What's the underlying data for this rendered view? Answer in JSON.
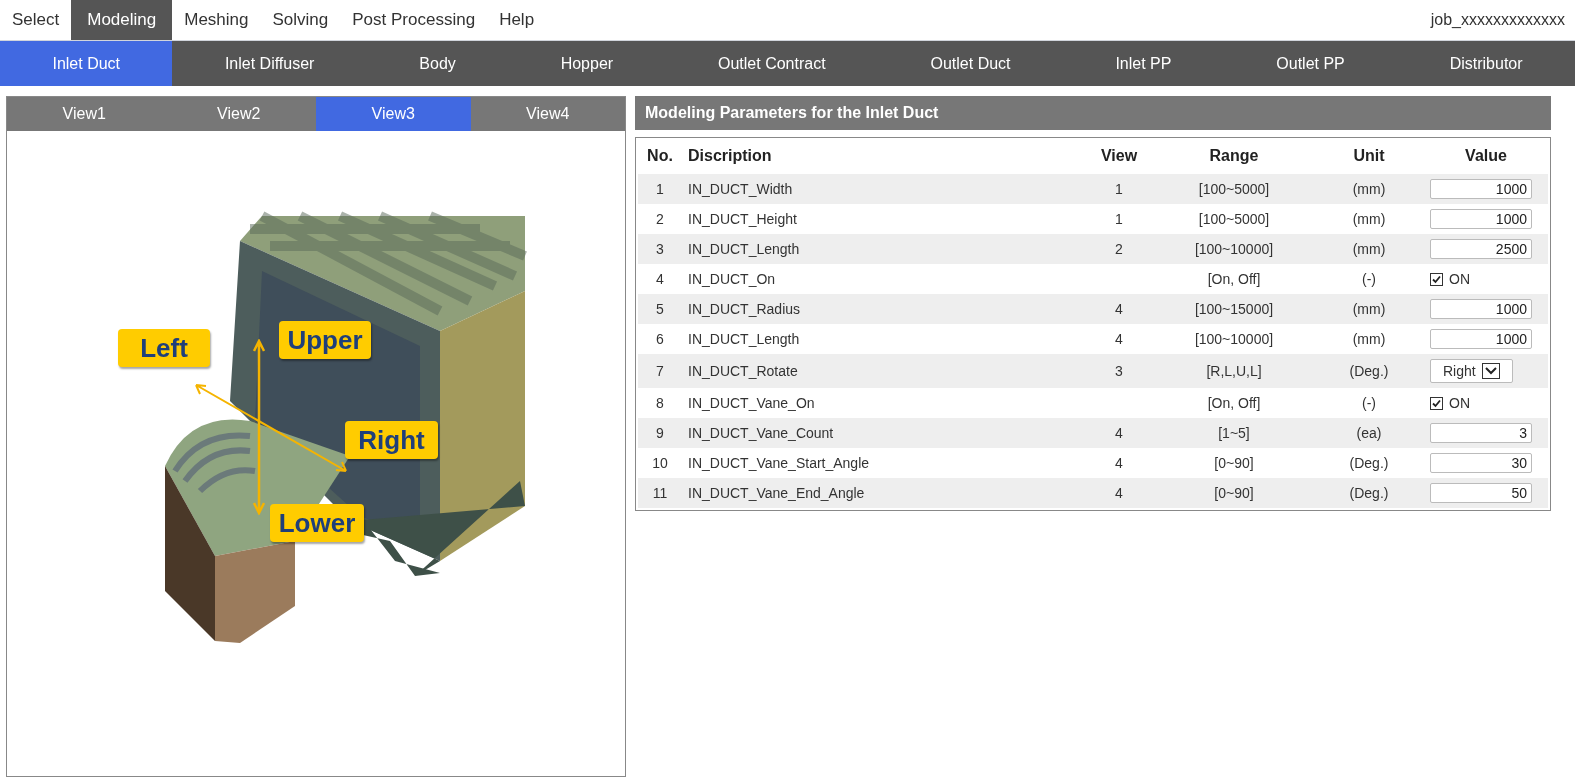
{
  "menu": {
    "items": [
      {
        "label": "Select",
        "selected": false
      },
      {
        "label": "Modeling",
        "selected": true
      },
      {
        "label": "Meshing",
        "selected": false
      },
      {
        "label": "Solving",
        "selected": false
      },
      {
        "label": "Post Processing",
        "selected": false
      },
      {
        "label": "Help",
        "selected": false
      }
    ],
    "job": "job_xxxxxxxxxxxxx"
  },
  "part_tabs": [
    {
      "label": "Inlet Duct",
      "selected": true
    },
    {
      "label": "Inlet Diffuser",
      "selected": false
    },
    {
      "label": "Body",
      "selected": false
    },
    {
      "label": "Hopper",
      "selected": false
    },
    {
      "label": "Outlet Contract",
      "selected": false
    },
    {
      "label": "Outlet Duct",
      "selected": false
    },
    {
      "label": "Inlet PP",
      "selected": false
    },
    {
      "label": "Outlet PP",
      "selected": false
    },
    {
      "label": "Distributor",
      "selected": false
    }
  ],
  "view_panel": {
    "tabs": [
      {
        "label": "View1",
        "selected": false
      },
      {
        "label": "View2",
        "selected": false
      },
      {
        "label": "View3",
        "selected": true
      },
      {
        "label": "View4",
        "selected": false
      }
    ],
    "labels": [
      "Left",
      "Upper",
      "Right",
      "Lower"
    ]
  },
  "parameters": {
    "title": "Modeling Parameters for the Inlet Duct",
    "columns": [
      "No.",
      "Discription",
      "View",
      "Range",
      "Unit",
      "Value"
    ],
    "rows": [
      {
        "no": "1",
        "description": "IN_DUCT_Width",
        "view": "1",
        "range": "[100~5000]",
        "unit": "(mm)",
        "kind": "number",
        "value": "1000"
      },
      {
        "no": "2",
        "description": "IN_DUCT_Height",
        "view": "1",
        "range": "[100~5000]",
        "unit": "(mm)",
        "kind": "number",
        "value": "1000"
      },
      {
        "no": "3",
        "description": "IN_DUCT_Length",
        "view": "2",
        "range": "[100~10000]",
        "unit": "(mm)",
        "kind": "number",
        "value": "2500"
      },
      {
        "no": "4",
        "description": "IN_DUCT_On",
        "range": "[On, Off]",
        "unit": "(-)",
        "kind": "checkbox",
        "checked": true,
        "value": "ON"
      },
      {
        "no": "5",
        "description": "IN_DUCT_Radius",
        "view": "4",
        "range": "[100~15000]",
        "unit": "(mm)",
        "kind": "number",
        "value": "1000"
      },
      {
        "no": "6",
        "description": "IN_DUCT_Length",
        "view": "4",
        "range": "[100~10000]",
        "unit": "(mm)",
        "kind": "number",
        "value": "1000"
      },
      {
        "no": "7",
        "description": "IN_DUCT_Rotate",
        "view": "3",
        "range": "[R,L,U,L]",
        "unit": "(Deg.)",
        "kind": "select",
        "value": "Right"
      },
      {
        "no": "8",
        "description": "IN_DUCT_Vane_On",
        "range": "[On, Off]",
        "unit": "(-)",
        "kind": "checkbox",
        "checked": true,
        "value": "ON"
      },
      {
        "no": "9",
        "description": "IN_DUCT_Vane_Count",
        "view": "4",
        "range": "[1~5]",
        "unit": "(ea)",
        "kind": "number",
        "value": "3"
      },
      {
        "no": "10",
        "description": "IN_DUCT_Vane_Start_Angle",
        "view": "4",
        "range": "[0~90]",
        "unit": "(Deg.)",
        "kind": "number",
        "value": "30"
      },
      {
        "no": "11",
        "description": "IN_DUCT_Vane_End_Angle",
        "view": "4",
        "range": "[0~90]",
        "unit": "(Deg.)",
        "kind": "number",
        "value": "50"
      }
    ]
  }
}
